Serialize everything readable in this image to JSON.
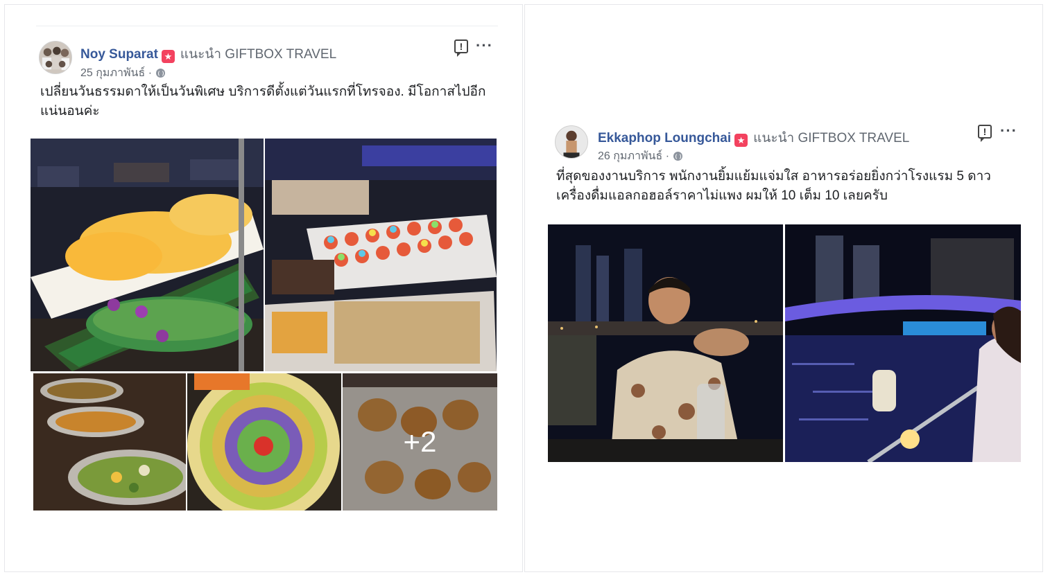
{
  "posts": [
    {
      "author": "Noy Suparat",
      "badge_icon": "star-icon",
      "recommends": "แนะนำ GIFTBOX TRAVEL",
      "date": "25 กุมภาพันธ์ ·",
      "text": "เปลี่ยนวันธรรมดาให้เป็นวันพิเศษ บริการดีตั้งแต่วันแรกที่โทรจอง. มีโอกาสไปอีก แน่นอนค่ะ",
      "more_photos": "+2"
    },
    {
      "author": "Ekkaphop Loungchai",
      "badge_icon": "star-icon",
      "recommends": "แนะนำ GIFTBOX TRAVEL",
      "date": "26 กุมภาพันธ์ ·",
      "text": "ที่สุดของงานบริการ พนักงานยิ้มแย้มแจ่มใส อาหารอร่อยยิ่งกว่าโรงแรม 5 ดาว เครื่องดื่มแอลกอฮอล์ราคาไม่แพง ผมให้ 10 เต็ม 10 เลยครับ"
    }
  ],
  "icons": {
    "report": "report-icon",
    "more": "more-options-icon",
    "privacy": "globe-icon"
  },
  "colors": {
    "author_name": "#365899",
    "badge": "#f3425f",
    "meta_text": "#606770"
  }
}
